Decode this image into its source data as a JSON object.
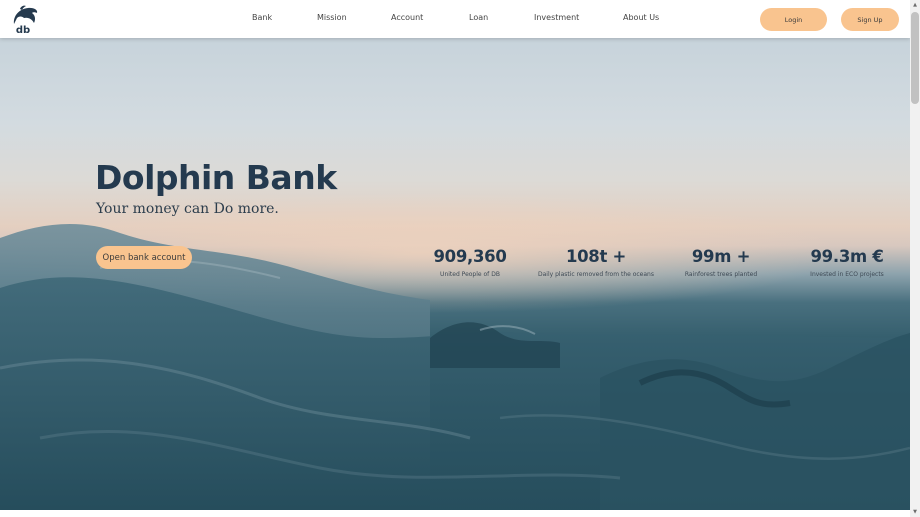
{
  "brand": {
    "logo_text": "db"
  },
  "nav": {
    "links": [
      {
        "label": "Bank"
      },
      {
        "label": "Mission"
      },
      {
        "label": "Account"
      },
      {
        "label": "Loan"
      },
      {
        "label": "Investment"
      },
      {
        "label": "About Us"
      }
    ],
    "login_label": "Login",
    "signup_label": "Sign Up"
  },
  "hero": {
    "title": "Dolphin Bank",
    "tagline": "Your money can Do more.",
    "cta_label": "Open bank account"
  },
  "stats": [
    {
      "value": "909,360",
      "label": "United People of DB"
    },
    {
      "value": "108t +",
      "label": "Daily plastic removed from the oceans"
    },
    {
      "value": "99m +",
      "label": "Rainforest trees planted"
    },
    {
      "value": "99.3m €",
      "label": "Invested in ECO projects"
    }
  ],
  "colors": {
    "accent": "#f9c48f",
    "heading": "#243a4f",
    "ocean": "#2f5968"
  }
}
